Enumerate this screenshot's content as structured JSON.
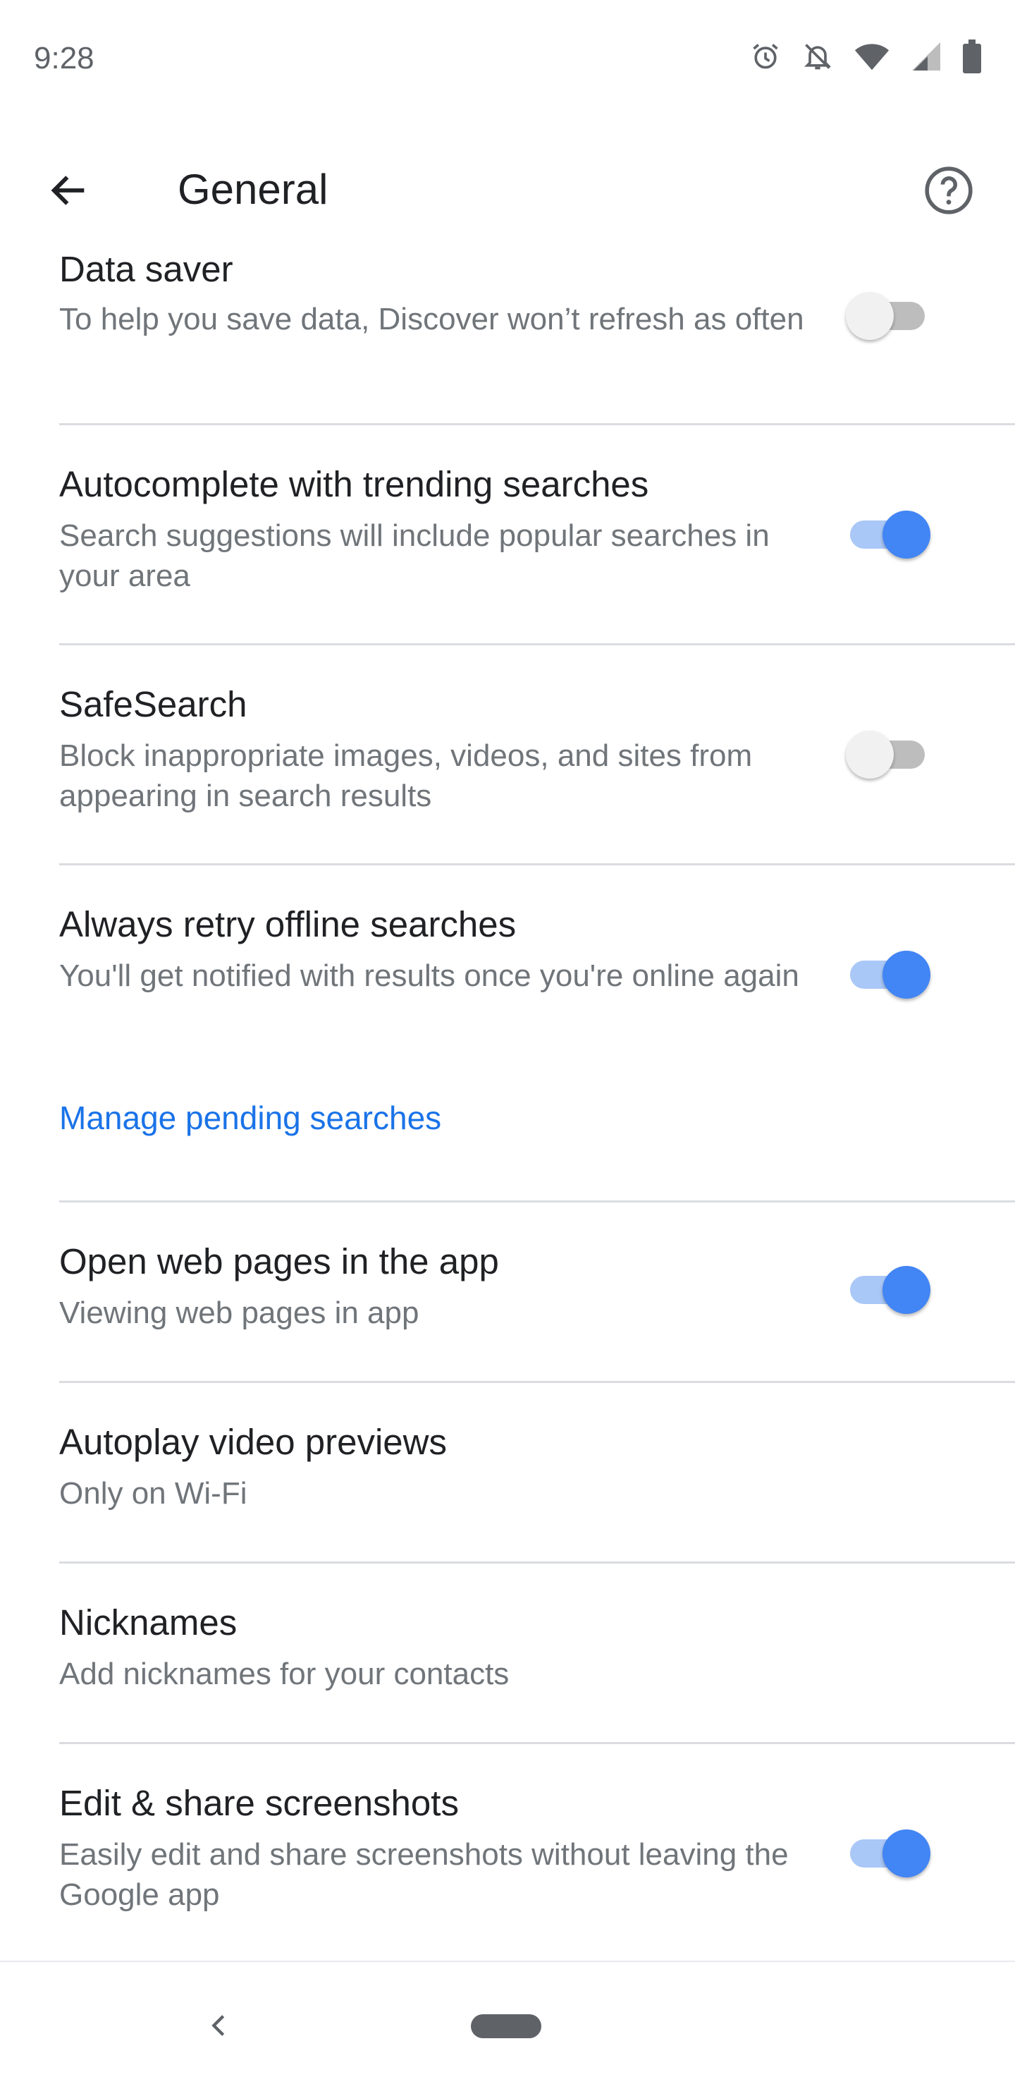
{
  "status_bar": {
    "time": "9:28",
    "icons": [
      "alarm-icon",
      "notifications-off-icon",
      "wifi-icon",
      "cell-signal-icon",
      "battery-icon"
    ]
  },
  "app_bar": {
    "title": "General",
    "back_icon": "arrow-back-icon",
    "help_icon": "help-icon"
  },
  "colors": {
    "accent": "#4285f4",
    "link": "#1a73e8",
    "text_primary": "#202124",
    "text_secondary": "#70757a",
    "divider": "#dadce0"
  },
  "settings": [
    {
      "title": "Data saver",
      "description": "To help you save data, Discover won’t refresh as often",
      "toggle": "off"
    },
    {
      "title": "Autocomplete with trending searches",
      "description": "Search suggestions will include popular searches in your area",
      "toggle": "on"
    },
    {
      "title": "SafeSearch",
      "description": "Block inappropriate images, videos, and sites from appearing in search results",
      "toggle": "off"
    },
    {
      "title": "Always retry offline searches",
      "description": "You'll get notified with results once you're online again",
      "toggle": "on",
      "link": "Manage pending searches"
    },
    {
      "title": "Open web pages in the app",
      "description": "Viewing web pages in app",
      "toggle": "on"
    },
    {
      "title": "Autoplay video previews",
      "description": "Only on Wi-Fi"
    },
    {
      "title": "Nicknames",
      "description": "Add nicknames for your contacts"
    },
    {
      "title": "Edit & share screenshots",
      "description": "Easily edit and share screenshots without leaving the Google app",
      "toggle": "on"
    }
  ],
  "nav_bar": {
    "back_icon": "nav-back-icon",
    "home_icon": "nav-home-pill-icon"
  }
}
